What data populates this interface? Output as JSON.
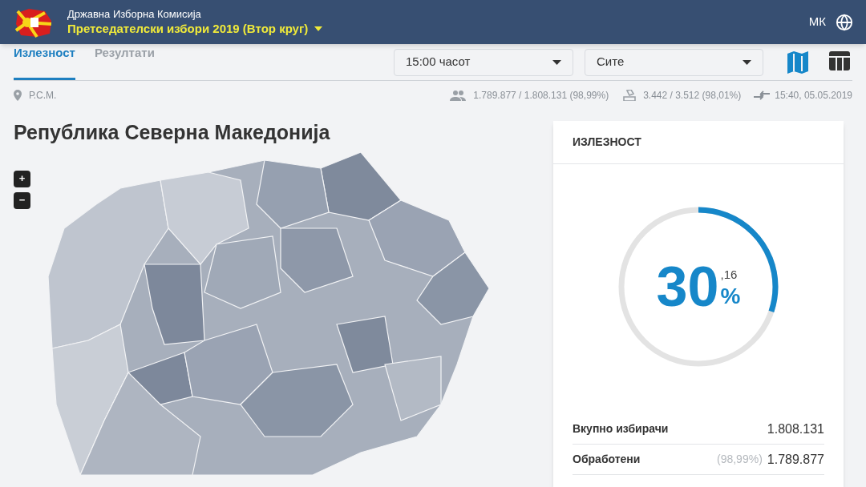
{
  "header": {
    "org": "Државна Изборна Комисија",
    "election": "Претседателски избори 2019 (Втор круг)",
    "language": "МК"
  },
  "tabs": [
    {
      "label": "Излезност",
      "selected": true
    },
    {
      "label": "Резултати",
      "selected": false
    }
  ],
  "filters": [
    {
      "value": "15:00 часот"
    },
    {
      "value": "Сите"
    }
  ],
  "views": [
    {
      "kind": "map",
      "selected": true
    },
    {
      "kind": "table",
      "selected": false
    }
  ],
  "info": {
    "location": "Р.С.М.",
    "voters": "1.789.877 / 1.808.131 (98,99%)",
    "stations": "3.442 / 3.512 (98,01%)",
    "updated": "15:40, 05.05.2019"
  },
  "region_title": "Република Северна Македонија",
  "zoom": [
    "+",
    "−"
  ],
  "card": {
    "title": "ИЗЛЕЗНОСТ",
    "gauge": {
      "level": 0.3016,
      "integer": "30",
      "decimal": ",16",
      "unit": "%"
    },
    "rows": [
      {
        "label": "Вкупно избирачи",
        "note": "",
        "value": "1.808.131"
      },
      {
        "label": "Обработени",
        "note": "(98,99%)",
        "value": "1.789.877"
      }
    ]
  }
}
